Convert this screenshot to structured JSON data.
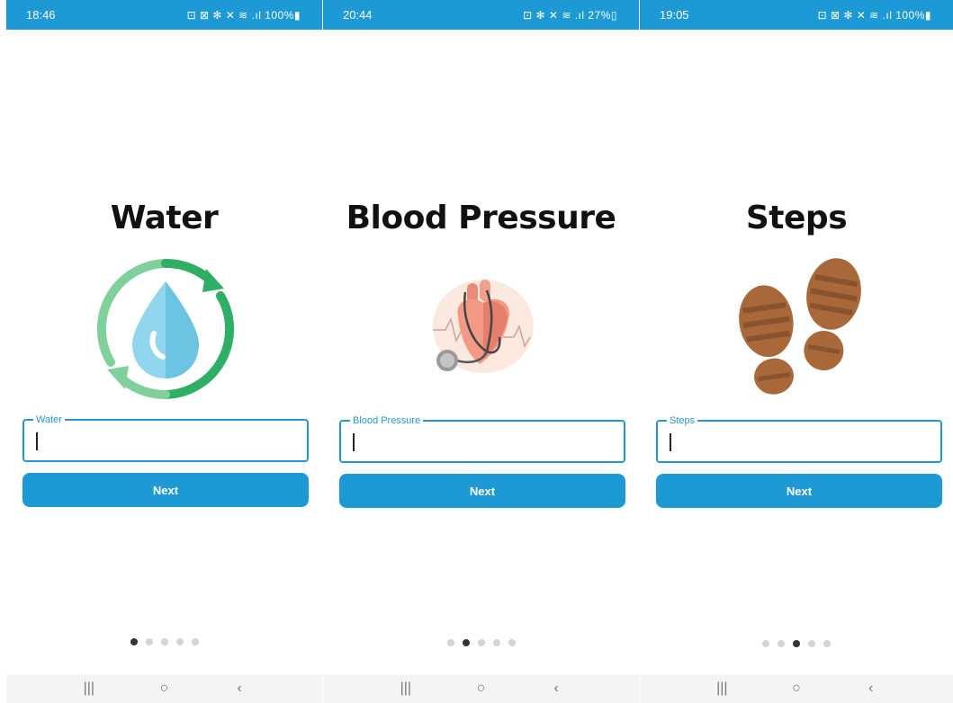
{
  "screens": [
    {
      "status": {
        "time": "18:46",
        "icons": "⊡ ⊠ ✻ ✕ ≋ .ıl 100%▮"
      },
      "title": "Water",
      "field": {
        "label": "Water",
        "value": ""
      },
      "next_label": "Next",
      "dots": {
        "count": 5,
        "active": 0
      },
      "illustration": "water-cycle-icon"
    },
    {
      "status": {
        "time": "20:44",
        "icons": "⊡ ✻ ✕ ≋ .ıl 27%▯"
      },
      "title": "Blood Pressure",
      "field": {
        "label": "Blood Pressure",
        "value": ""
      },
      "next_label": "Next",
      "dots": {
        "count": 5,
        "active": 1
      },
      "illustration": "heart-stethoscope-icon"
    },
    {
      "status": {
        "time": "19:05",
        "icons": "⊡ ⊠ ✻ ✕ ≋ .ıl 100%▮"
      },
      "title": "Steps",
      "field": {
        "label": "Steps",
        "value": ""
      },
      "next_label": "Next",
      "dots": {
        "count": 5,
        "active": 2
      },
      "illustration": "footprints-icon"
    }
  ],
  "nav": {
    "recents": "|||",
    "home": "○",
    "back": "‹"
  },
  "colors": {
    "accent": "#1d9ad6",
    "status_bar": "#1d9ad6",
    "dot_active": "#333333",
    "dot_inactive": "#d4d4d4"
  }
}
